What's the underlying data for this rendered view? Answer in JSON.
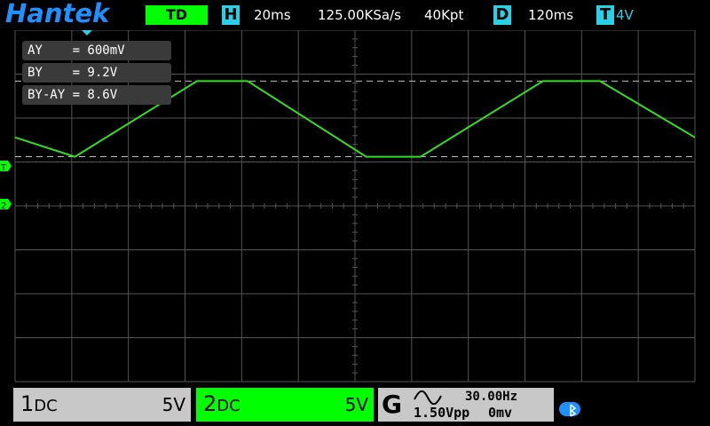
{
  "brand": "Hantek",
  "top": {
    "mode": "TD",
    "h_label": "H",
    "timebase": "20ms",
    "sample_rate": "125.00KSa/s",
    "memory_depth": "40Kpt",
    "d_label": "D",
    "delay": "120ms",
    "t_label": "T",
    "trigger_level": "4V"
  },
  "cursors": {
    "ay": "AY    = 600mV",
    "by": "BY    = 9.2V",
    "diff": "BY-AY = 8.6V"
  },
  "markers": {
    "trigger": "T",
    "channel2": "2"
  },
  "ch1": {
    "number": "1",
    "coupling": "DC",
    "volts_div": "5V"
  },
  "ch2": {
    "number": "2",
    "coupling": "DC",
    "volts_div": "5V"
  },
  "generator": {
    "label": "G",
    "frequency": "30.00Hz",
    "amplitude": "1.50Vpp",
    "offset": "0mv",
    "waveform": "sine-wave-icon"
  },
  "chart_data": {
    "type": "line",
    "series": [
      {
        "values_time_ms": [
          0,
          17.6,
          53.5,
          68.4,
          103.3,
          119.3,
          155.3,
          172.1,
          200
        ],
        "values_volts": [
          2.8,
          0.6,
          9.2,
          9.2,
          0.6,
          0.6,
          9.2,
          9.2,
          2.8
        ]
      }
    ],
    "xlim_ms": [
      0,
      200
    ],
    "ylim_volts": [
      -25,
      15
    ],
    "grid": true,
    "colors": {
      "trace": "#33dd22",
      "grid": "#555555",
      "cursor_line": "#bfbfbf"
    }
  },
  "colors": {
    "accent": "#00ff00",
    "info": "#2ad0e6",
    "logo": "#1e90ff"
  }
}
